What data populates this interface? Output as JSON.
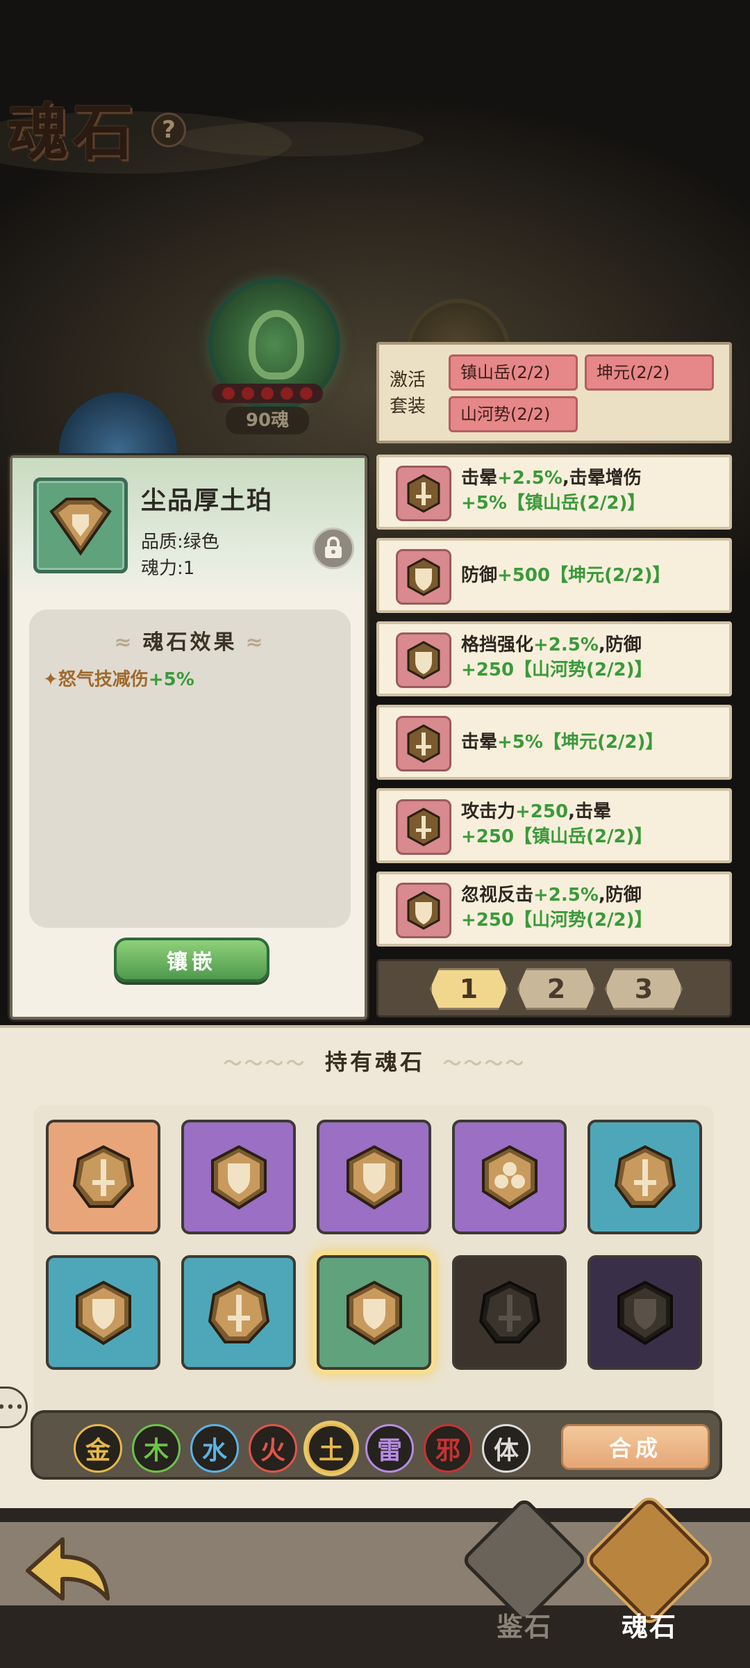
{
  "header": {
    "title": "魂石",
    "help_icon": "?"
  },
  "scene": {
    "orb_count": "90魂"
  },
  "detail": {
    "name": "尘品厚土珀",
    "quality": "品质:绿色",
    "power": "魂力:1",
    "effect_title": "魂石效果",
    "effect_bullet": "✦",
    "effect_text": "怒气技减伤",
    "effect_value": "+5%",
    "embed_label": "镶嵌"
  },
  "set_box": {
    "label": "激活套装",
    "tags": [
      "镇山岳(2/2)",
      "坤元(2/2)",
      "山河势(2/2)"
    ]
  },
  "effects": [
    {
      "icon": "sword-icon",
      "line1": "击晕",
      "line1_green": "+2.5%",
      "line1_rest": ",击晕增伤",
      "line2_green": "+5%【镇山岳(2/2)】"
    },
    {
      "icon": "shield-icon",
      "line1": "防御",
      "line1_green": "+500【坤元(2/2)】",
      "line1_rest": "",
      "line2_green": ""
    },
    {
      "icon": "shield-icon",
      "line1": "格挡强化",
      "line1_green": "+2.5%",
      "line1_rest": ",防御",
      "line2_green": "+250【山河势(2/2)】"
    },
    {
      "icon": "sword-icon",
      "line1": "击晕",
      "line1_green": "+5%【坤元(2/2)】",
      "line1_rest": "",
      "line2_green": ""
    },
    {
      "icon": "sword-icon",
      "line1": "攻击力",
      "line1_green": "+250",
      "line1_rest": ",击晕",
      "line2_green": "+250【镇山岳(2/2)】"
    },
    {
      "icon": "shield-icon",
      "line1": "忽视反击",
      "line1_green": "+2.5%",
      "line1_rest": ",防御",
      "line2_green": "+250【山河势(2/2)】"
    }
  ],
  "pager": {
    "pages": [
      "1",
      "2",
      "3"
    ],
    "active": "1"
  },
  "inventory": {
    "title": "持有魂石",
    "slots": [
      {
        "color": "#e8a57a",
        "gem": "sword"
      },
      {
        "color": "#9a6fc4",
        "gem": "shield"
      },
      {
        "color": "#9a6fc4",
        "gem": "shield"
      },
      {
        "color": "#9a6fc4",
        "gem": "swirl"
      },
      {
        "color": "#4ea7b8",
        "gem": "sword"
      },
      {
        "color": "#4ea7b8",
        "gem": "shield"
      },
      {
        "color": "#4ea7b8",
        "gem": "sword"
      },
      {
        "color": "#5fa27c",
        "gem": "shield",
        "selected": true
      },
      {
        "color": "#3c342c",
        "gem": "sword-dark"
      },
      {
        "color": "#3a2f48",
        "gem": "shield-dark"
      }
    ]
  },
  "elements": {
    "items": [
      {
        "label": "金",
        "color": "#e6b84a"
      },
      {
        "label": "木",
        "color": "#6cc24a"
      },
      {
        "label": "水",
        "color": "#5ab4e4"
      },
      {
        "label": "火",
        "color": "#e0554a"
      },
      {
        "label": "土",
        "color": "#e6b84a",
        "selected": true
      },
      {
        "label": "雷",
        "color": "#b58ce0"
      },
      {
        "label": "邪",
        "color": "#c83232"
      },
      {
        "label": "体",
        "color": "#dcdcdc"
      }
    ],
    "synth_label": "合成"
  },
  "bottom_nav": {
    "tab1": "鉴石",
    "tab2": "魂石"
  }
}
